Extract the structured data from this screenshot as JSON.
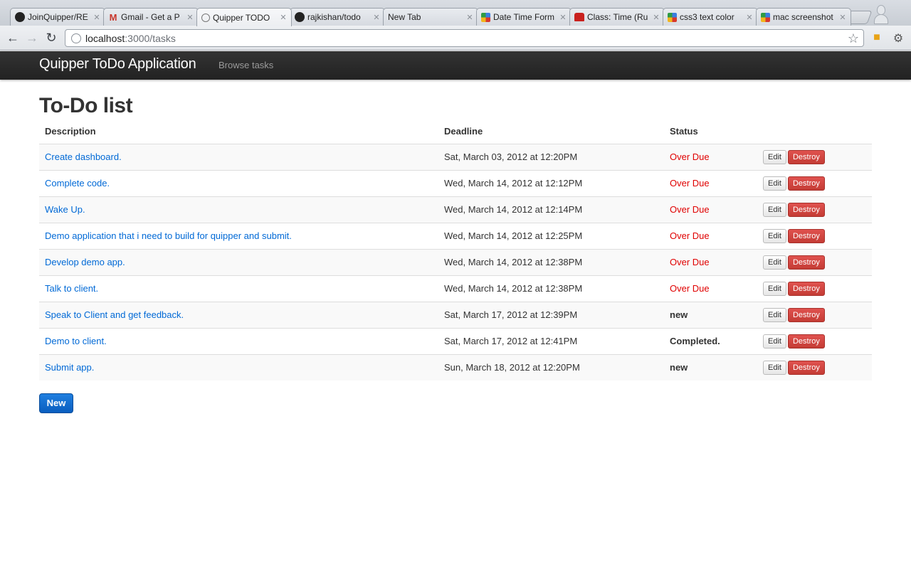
{
  "browser": {
    "tabs": [
      {
        "title": "JoinQuipper/RE",
        "icon": "github-icon"
      },
      {
        "title": "Gmail - Get a P",
        "icon": "gmail-icon"
      },
      {
        "title": "Quipper TODO",
        "icon": "globe-icon",
        "active": true
      },
      {
        "title": "rajkishan/todo",
        "icon": "github-icon"
      },
      {
        "title": "New Tab",
        "icon": ""
      },
      {
        "title": "Date Time Form",
        "icon": "google-icon"
      },
      {
        "title": "Class: Time (Ru",
        "icon": "ruby-icon"
      },
      {
        "title": "css3 text color",
        "icon": "google-icon"
      },
      {
        "title": "mac screenshot",
        "icon": "google-icon"
      }
    ],
    "url_host": "localhost",
    "url_path": ":3000/tasks"
  },
  "app": {
    "brand": "Quipper ToDo Application",
    "nav_browse": "Browse tasks"
  },
  "page": {
    "title": "To-Do list",
    "columns": {
      "description": "Description",
      "deadline": "Deadline",
      "status": "Status"
    },
    "edit_label": "Edit",
    "destroy_label": "Destroy",
    "new_label": "New"
  },
  "tasks": [
    {
      "description": "Create dashboard.",
      "deadline": "Sat, March 03, 2012 at 12:20PM",
      "status": "Over Due"
    },
    {
      "description": "Complete code.",
      "deadline": "Wed, March 14, 2012 at 12:12PM",
      "status": "Over Due"
    },
    {
      "description": "Wake Up.",
      "deadline": "Wed, March 14, 2012 at 12:14PM",
      "status": "Over Due"
    },
    {
      "description": "Demo application that i need to build for quipper and submit.",
      "deadline": "Wed, March 14, 2012 at 12:25PM",
      "status": "Over Due"
    },
    {
      "description": "Develop demo app.",
      "deadline": "Wed, March 14, 2012 at 12:38PM",
      "status": "Over Due"
    },
    {
      "description": "Talk to client.",
      "deadline": "Wed, March 14, 2012 at 12:38PM",
      "status": "Over Due"
    },
    {
      "description": "Speak to Client and get feedback.",
      "deadline": "Sat, March 17, 2012 at 12:39PM",
      "status": "new"
    },
    {
      "description": "Demo to client.",
      "deadline": "Sat, March 17, 2012 at 12:41PM",
      "status": "Completed."
    },
    {
      "description": "Submit app.",
      "deadline": "Sun, March 18, 2012 at 12:20PM",
      "status": "new"
    }
  ],
  "colors": {
    "navbar": "#222222",
    "link": "#0069d6",
    "overdue": "#e00000",
    "destroy": "#c43c35",
    "primary": "#0a5ebf"
  }
}
